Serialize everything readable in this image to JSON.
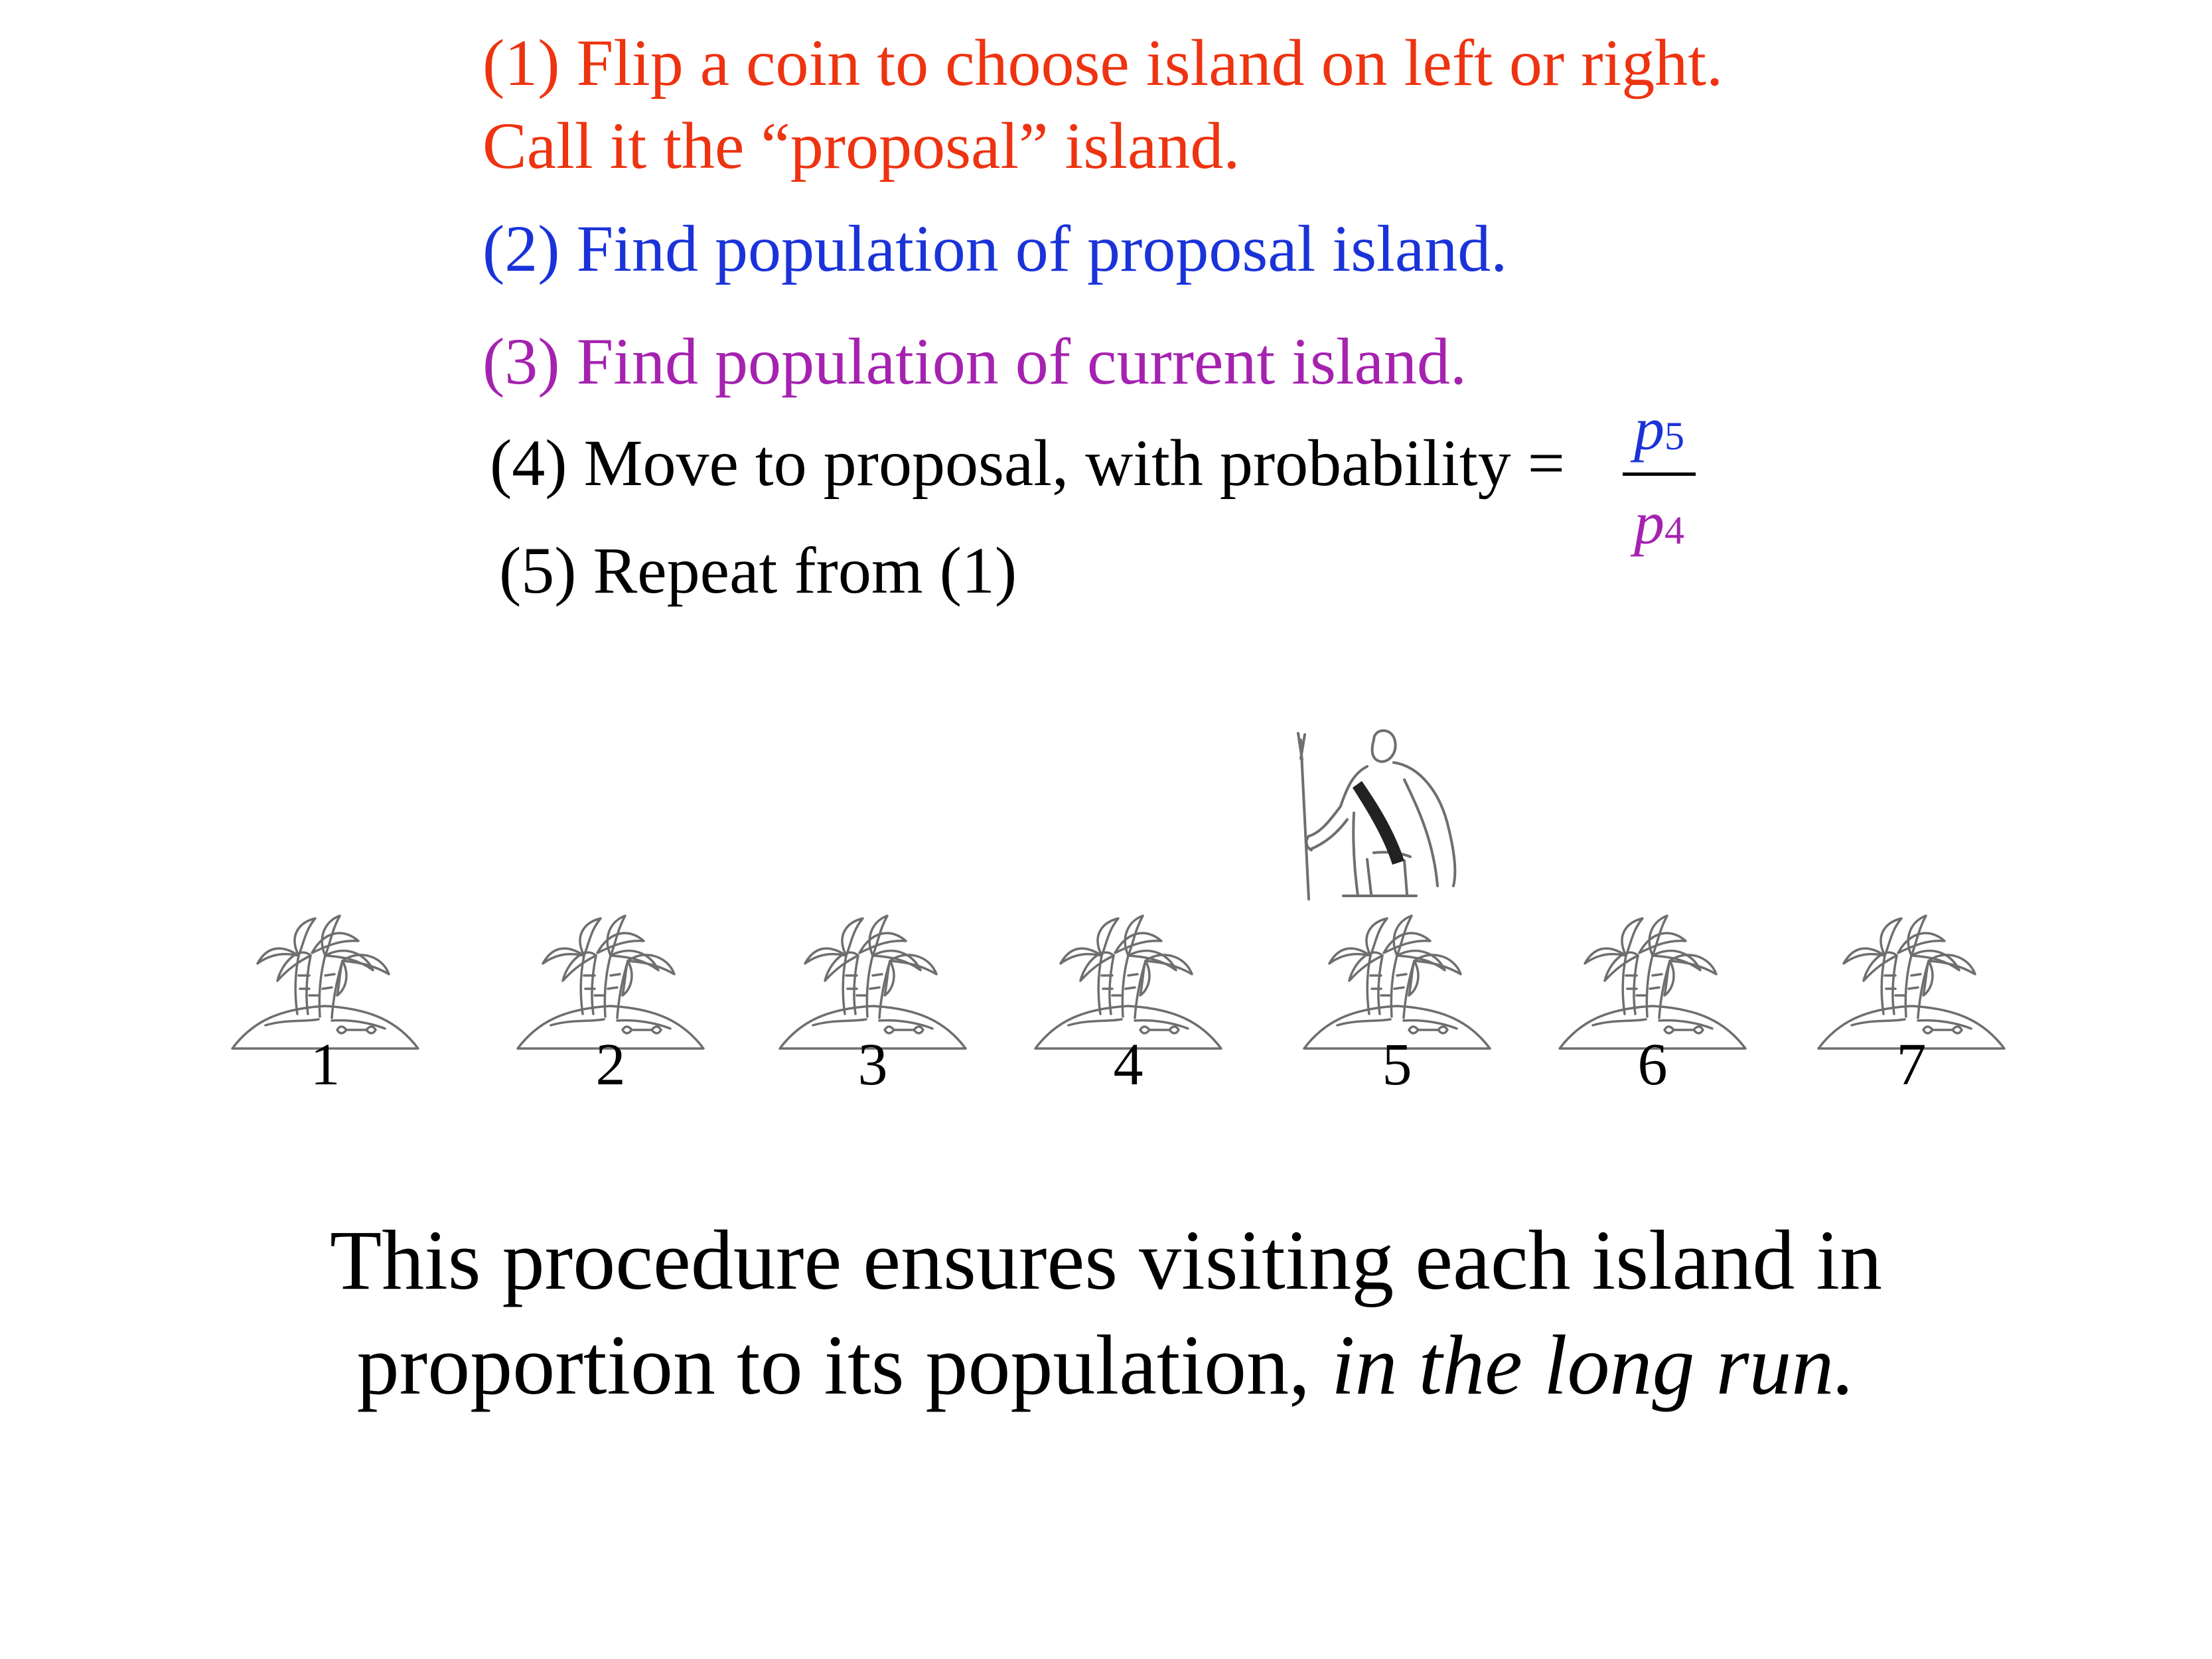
{
  "colors": {
    "step1": "#ee3311",
    "step2": "#1a33d9",
    "step3": "#a522b0",
    "text": "#000000",
    "sketch": "#6e6e6e"
  },
  "steps": {
    "step1_line1": "(1) Flip a coin to choose island on left or right.",
    "step1_line2": "Call it the “proposal” island.",
    "step2": "(2) Find population of proposal island.",
    "step3": "(3) Find population of current island.",
    "step4": "(4) Move to proposal, with probability =",
    "step5": "(5) Repeat from (1)"
  },
  "fraction": {
    "numerator_var": "p",
    "numerator_sub": "5",
    "denominator_var": "p",
    "denominator_sub": "4"
  },
  "islands": [
    {
      "label": "1"
    },
    {
      "label": "2"
    },
    {
      "label": "3"
    },
    {
      "label": "4"
    },
    {
      "label": "5"
    },
    {
      "label": "6"
    },
    {
      "label": "7"
    }
  ],
  "explorer": {
    "icon": "explorer-with-staff-icon",
    "island_label": "5"
  },
  "conclusion": {
    "line1": "This procedure ensures visiting each island in",
    "line2_plain": "proportion to its population, ",
    "line2_italic": "in the long run."
  }
}
